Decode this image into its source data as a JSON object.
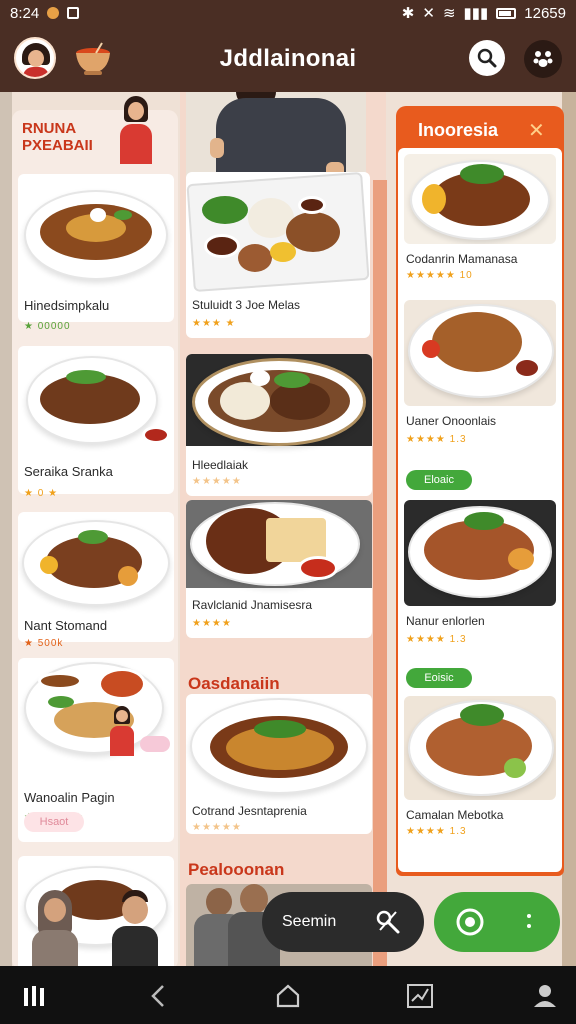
{
  "status_bar": {
    "time": "8:24",
    "battery": "12659"
  },
  "app_bar": {
    "title": "Jddlainonai"
  },
  "panel1": {
    "header": "RNUNA PXEABAII",
    "items": [
      {
        "name": "Hinedsimpkalu",
        "rating": "★ 00000"
      },
      {
        "name": "Seraika Sranka",
        "rating": "★ 0 ★"
      },
      {
        "name": "Nant Stomand",
        "rating": "★ 500k"
      },
      {
        "name": "Wanoalin Pagin",
        "rating": "★★★★★★"
      }
    ],
    "tag": "Hsaot"
  },
  "panel2": {
    "items": [
      {
        "name": "Stuluidt 3 Joe Melas",
        "rating": "★★★ ★"
      },
      {
        "name": "Hleedlaiak",
        "rating": "★★★★★"
      },
      {
        "name": "Ravlclanid Jnamisesra",
        "rating": "★★★★"
      },
      {
        "name": "Cotrand Jesntaprenia",
        "rating": "★★★★★"
      }
    ],
    "section1": "Oasdanaiin",
    "section2": "Pealooonan"
  },
  "panel3": {
    "title": "Inooresia",
    "items": [
      {
        "name": "Codanrin Mamanasa",
        "rating": "★★★★★ 10"
      },
      {
        "name": "Uaner Onoonlais",
        "rating": "★★★★ 1.3"
      },
      {
        "name": "Nanur enlorlen",
        "rating": "★★★★ 1.3"
      },
      {
        "name": "Camalan Mebotka",
        "rating": "★★★★ 1.3"
      }
    ],
    "pills": [
      "Eloaic",
      "Eoisic"
    ]
  },
  "bottom": {
    "search_label": "Seemin"
  },
  "colors": {
    "appbar": "#4a2e24",
    "accent": "#e85b1e",
    "green": "#43a83b",
    "star": "#f0a11c"
  }
}
